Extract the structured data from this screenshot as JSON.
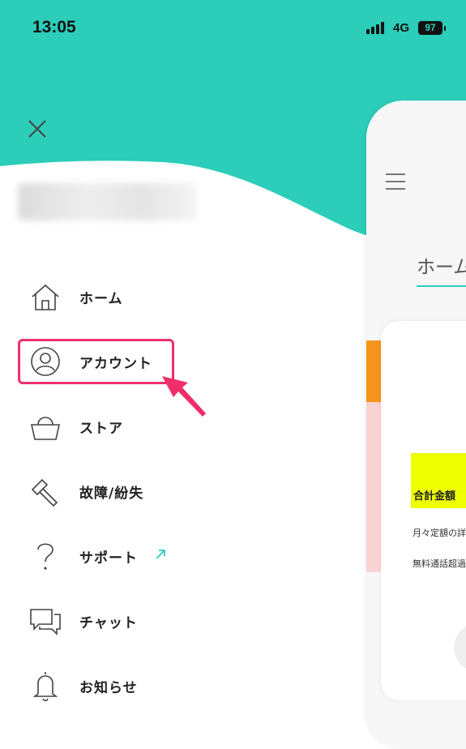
{
  "status_bar": {
    "time": "13:05",
    "network": "4G",
    "battery": "97"
  },
  "colors": {
    "teal": "#2CCDB9",
    "highlight": "#EF2F6B",
    "orange": "#F7941D",
    "pink": "#F9D2D3",
    "yellow": "#EEFF00"
  },
  "menu": {
    "items": [
      {
        "label": "ホーム",
        "icon": "home-icon"
      },
      {
        "label": "アカウント",
        "icon": "account-icon",
        "highlighted": true
      },
      {
        "label": "ストア",
        "icon": "basket-icon"
      },
      {
        "label": "故障/紛失",
        "icon": "hammer-icon"
      },
      {
        "label": "サポート",
        "icon": "question-icon",
        "external": true
      },
      {
        "label": "チャット",
        "icon": "chat-icon"
      },
      {
        "label": "お知らせ",
        "icon": "bell-icon"
      }
    ]
  },
  "preview": {
    "title": "ホーム",
    "total_label": "合計金額",
    "line1": "月々定額の詳",
    "line2": "無料通話超過"
  }
}
